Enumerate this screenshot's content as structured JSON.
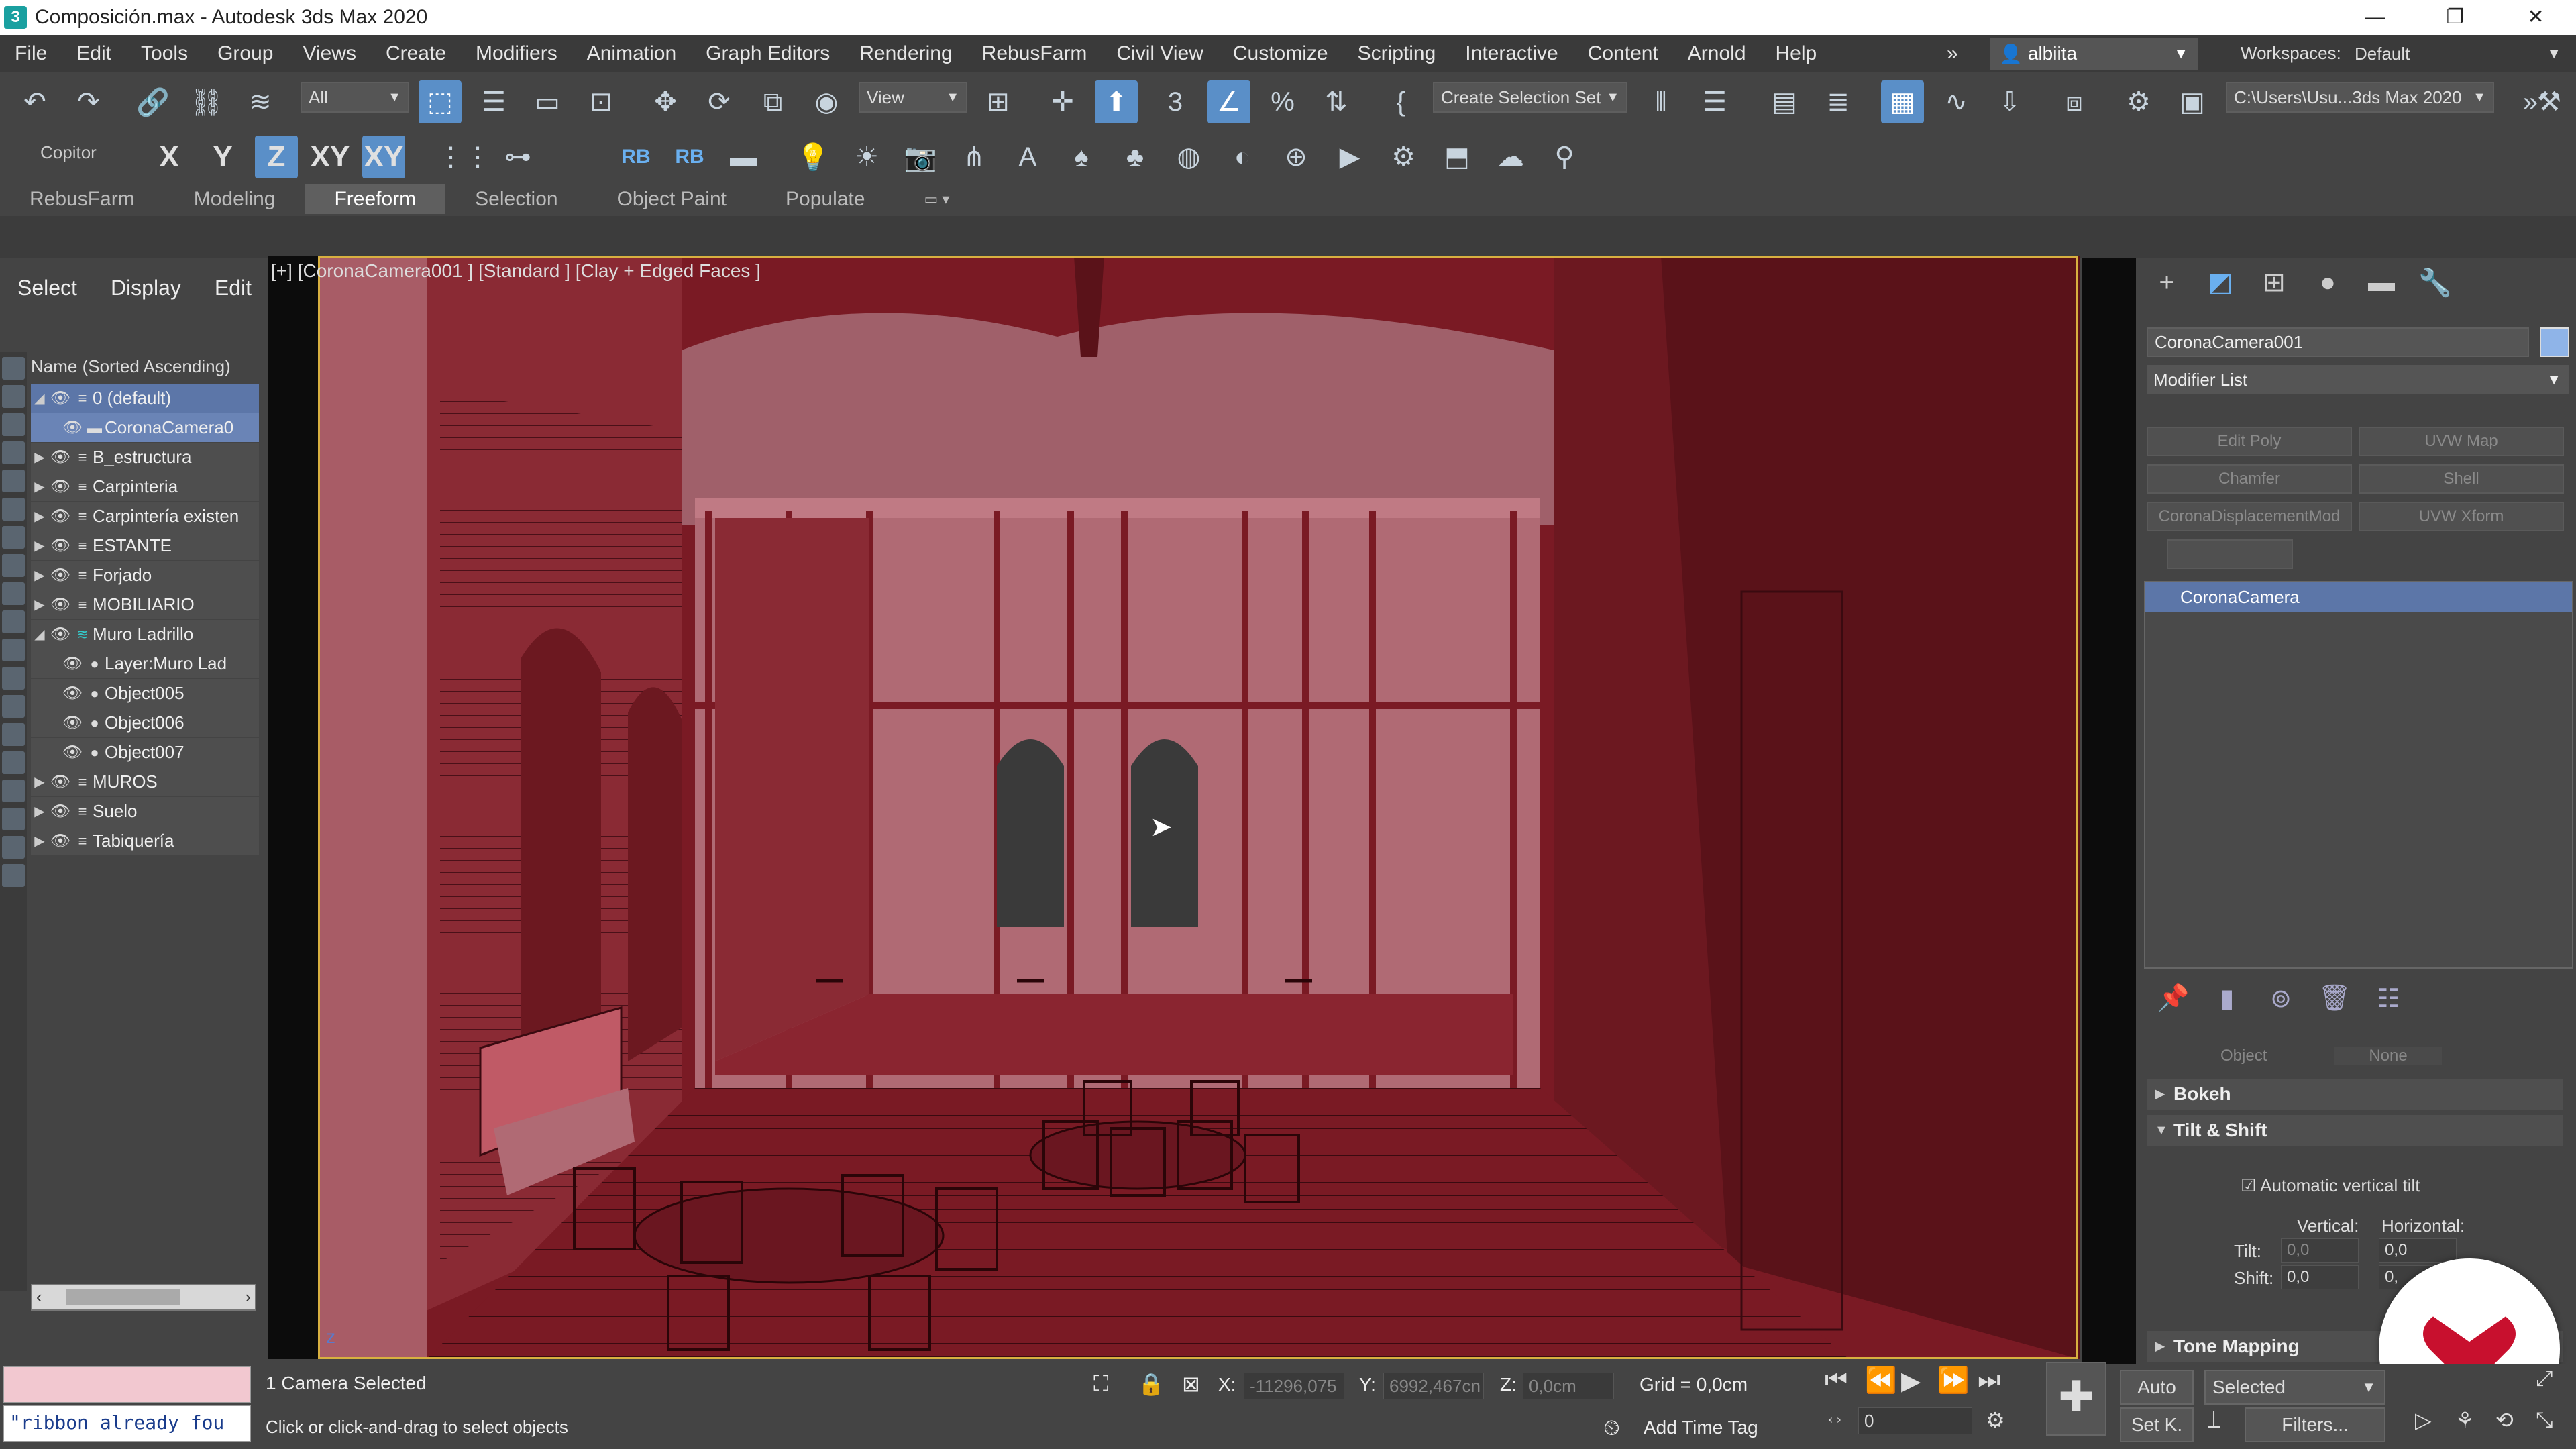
{
  "window": {
    "title": "Composición.max - Autodesk 3ds Max 2020",
    "app_icon": "3",
    "controls": [
      "—",
      "❐",
      "✕"
    ]
  },
  "menu": {
    "items": [
      "File",
      "Edit",
      "Tools",
      "Group",
      "Views",
      "Create",
      "Modifiers",
      "Animation",
      "Graph Editors",
      "Rendering",
      "RebusFarm",
      "Civil View",
      "Customize",
      "Scripting",
      "Interactive",
      "Content",
      "Arnold",
      "Help"
    ],
    "overflow": "»",
    "user": "albiita",
    "workspaces_label": "Workspaces:",
    "workspace_value": "Default"
  },
  "toolbar": {
    "selection_filter": "All",
    "ref_coord": "View",
    "selection_set": "Create Selection Set",
    "project_path": "C:\\Users\\Usu...3ds Max 2020",
    "copitor_label": "Copitor",
    "axis_x": "X",
    "axis_y": "Y",
    "axis_z": "Z",
    "axis_xy": "XY",
    "axis_xyz": "XY",
    "rb1": "RB",
    "rb2": "RB"
  },
  "ribbon": {
    "tabs": [
      "RebusFarm",
      "Modeling",
      "Freeform",
      "Selection",
      "Object Paint",
      "Populate"
    ],
    "active_tab": "Freeform"
  },
  "explorer": {
    "menu": [
      "Select",
      "Display",
      "Edit"
    ],
    "header": "Name (Sorted Ascending)",
    "rows": [
      {
        "name": "0 (default)",
        "level": 0,
        "expanded": true,
        "selected": true
      },
      {
        "name": "CoronaCamera0",
        "level": 1,
        "selected": true
      },
      {
        "name": "B_estructura",
        "level": 0
      },
      {
        "name": "Carpinteria",
        "level": 0
      },
      {
        "name": "Carpintería existen",
        "level": 0
      },
      {
        "name": "ESTANTE",
        "level": 0
      },
      {
        "name": "Forjado",
        "level": 0
      },
      {
        "name": "MOBILIARIO",
        "level": 0
      },
      {
        "name": "Muro Ladrillo",
        "level": 0,
        "expanded": true
      },
      {
        "name": "Layer:Muro Lad",
        "level": 1
      },
      {
        "name": "Object005",
        "level": 1
      },
      {
        "name": "Object006",
        "level": 1
      },
      {
        "name": "Object007",
        "level": 1
      },
      {
        "name": "MUROS",
        "level": 0
      },
      {
        "name": "Suelo",
        "level": 0
      },
      {
        "name": "Tabiquería",
        "level": 0
      }
    ]
  },
  "viewport": {
    "label": "[+] [CoronaCamera001 ] [Standard ] [Clay + Edged Faces ]",
    "wall_color": "#7a1a24",
    "ceiling_color": "#a0606a"
  },
  "command_panel": {
    "object_name": "CoronaCamera001",
    "object_color": "#8fb4e8",
    "modifier_list": "Modifier List",
    "modifier_buttons": [
      "Edit Poly",
      "UVW Map",
      "Chamfer",
      "Shell",
      "CoronaDisplacementMod",
      "UVW Xform"
    ],
    "stack_item": "CoronaCamera",
    "target_labels": [
      "Object",
      "None"
    ],
    "rollouts": {
      "bokeh": "Bokeh",
      "tilt_shift": "Tilt & Shift",
      "tone_mapping": "Tone Mapping"
    },
    "auto_vertical_tilt": "Automatic vertical tilt",
    "vertical_label": "Vertical:",
    "horizontal_label": "Horizontal:",
    "tilt_label": "Tilt:",
    "shift_label": "Shift:",
    "tilt_v": "0,0",
    "tilt_h": "0,0",
    "shift_v": "0,0",
    "shift_h": "0,"
  },
  "status": {
    "listener_text": "\"ribbon already fou",
    "selection_info": "1 Camera Selected",
    "prompt": "Click or click-and-drag to select objects",
    "x_label": "X:",
    "x_value": "-11296,075",
    "y_label": "Y:",
    "y_value": "6992,467cn",
    "z_label": "Z:",
    "z_value": "0,0cm",
    "grid": "Grid = 0,0cm",
    "add_time_tag": "Add Time Tag",
    "auto_key": "Auto",
    "set_key": "Set K.",
    "key_mode": "Selected",
    "filters": "Filters...",
    "frame": "0"
  }
}
